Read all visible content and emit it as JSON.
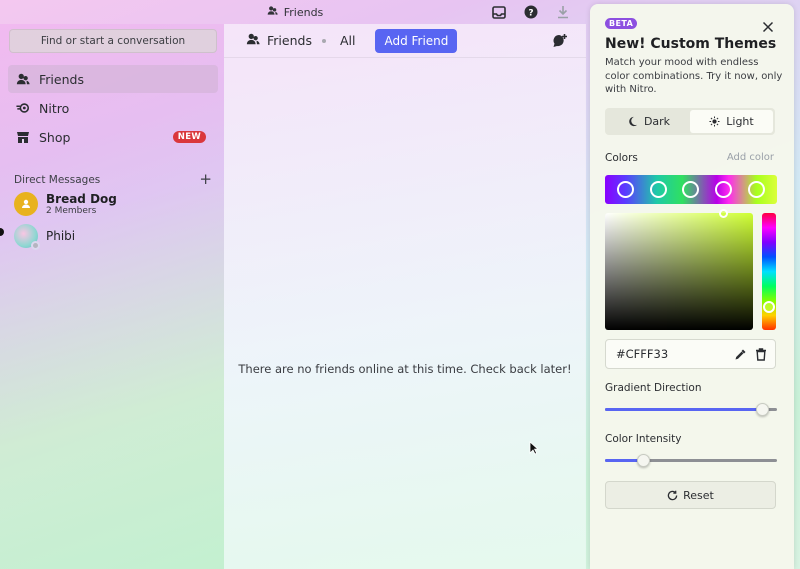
{
  "titlebar": {
    "title": "Friends"
  },
  "sidebar": {
    "search_label": "Find or start a conversation",
    "nav": [
      {
        "label": "Friends",
        "icon": "friends-icon"
      },
      {
        "label": "Nitro",
        "icon": "nitro-icon"
      },
      {
        "label": "Shop",
        "icon": "shop-icon",
        "badge": "NEW"
      }
    ],
    "dm_header": "Direct Messages",
    "dms": [
      {
        "name": "Bread Dog",
        "sub": "2 Members"
      },
      {
        "name": "Phibi"
      }
    ]
  },
  "main": {
    "header": {
      "friends": "Friends",
      "tab_all": "All",
      "add_friend": "Add Friend"
    },
    "empty_message": "There are no friends online at this time. Check back later!"
  },
  "theme_panel": {
    "badge": "BETA",
    "title": "New! Custom Themes",
    "description": "Match your mood with endless color combinations. Try it now, only with Nitro.",
    "mode_dark": "Dark",
    "mode_light": "Light",
    "selected_mode": "Light",
    "colors_label": "Colors",
    "add_color": "Add color",
    "hex_value": "#CFFF33",
    "gradient_label": "Gradient Direction",
    "gradient_value_pct": 91,
    "intensity_label": "Color Intensity",
    "intensity_value_pct": 22,
    "reset_label": "Reset",
    "accent": "#5865f2"
  }
}
